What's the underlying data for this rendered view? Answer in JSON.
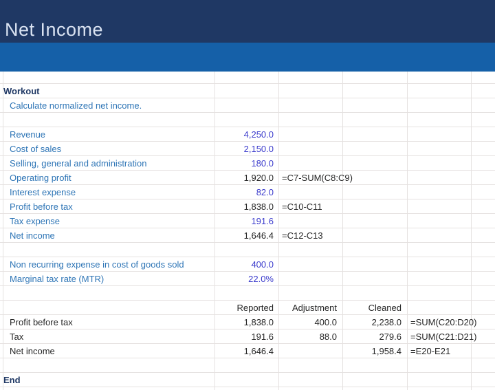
{
  "header": {
    "title": "Net Income"
  },
  "colors": {
    "navy": "#1f3864",
    "band": "#1560a8",
    "title_ink": "#d9e2f1",
    "label_blue": "#2e75b6",
    "input_blue": "#3b3bcc",
    "ink": "#262626",
    "grid": "#e5e1e0"
  },
  "sheet": {
    "rows": [
      {
        "type": "spacer"
      },
      {
        "type": "section",
        "label": "Workout"
      },
      {
        "type": "desc",
        "label": "Calculate normalized net income."
      },
      {
        "type": "empty"
      },
      {
        "type": "item",
        "label": "Revenue",
        "c": "4,250.0",
        "cStyle": "input"
      },
      {
        "type": "item",
        "label": "Cost of sales",
        "c": "2,150.0",
        "cStyle": "input"
      },
      {
        "type": "item",
        "label": "Selling, general and administration",
        "c": "180.0",
        "cStyle": "input"
      },
      {
        "type": "item",
        "label": "Operating profit",
        "c": "1,920.0",
        "cStyle": "calc",
        "formula": "=C7-SUM(C8:C9)",
        "formulaCol": "near"
      },
      {
        "type": "item",
        "label": "Interest expense",
        "c": "82.0",
        "cStyle": "input"
      },
      {
        "type": "item",
        "label": "Profit before tax",
        "c": "1,838.0",
        "cStyle": "calc",
        "formula": "=C10-C11",
        "formulaCol": "near"
      },
      {
        "type": "item",
        "label": "Tax expense",
        "c": "191.6",
        "cStyle": "input"
      },
      {
        "type": "item",
        "label": "Net income",
        "c": "1,646.4",
        "cStyle": "calc",
        "formula": "=C12-C13",
        "formulaCol": "near"
      },
      {
        "type": "empty"
      },
      {
        "type": "item",
        "label": "Non recurring expense in cost of goods sold",
        "c": "400.0",
        "cStyle": "input"
      },
      {
        "type": "item",
        "label": "Marginal tax rate (MTR)",
        "c": "22.0%",
        "cStyle": "input"
      },
      {
        "type": "empty"
      },
      {
        "type": "thead",
        "c": "Reported",
        "d": "Adjustment",
        "e": "Cleaned"
      },
      {
        "type": "item2",
        "label": "Profit before tax",
        "c": "1,838.0",
        "d": "400.0",
        "e": "2,238.0",
        "formula": "=SUM(C20:D20)",
        "formulaCol": "far"
      },
      {
        "type": "item2",
        "label": "Tax",
        "c": "191.6",
        "d": "88.0",
        "e": "279.6",
        "formula": "=SUM(C21:D21)",
        "formulaCol": "far"
      },
      {
        "type": "item2",
        "label": "Net income",
        "c": "1,646.4",
        "e": "1,958.4",
        "formula": "=E20-E21",
        "formulaCol": "far"
      },
      {
        "type": "empty"
      },
      {
        "type": "section",
        "label": "End"
      }
    ]
  }
}
